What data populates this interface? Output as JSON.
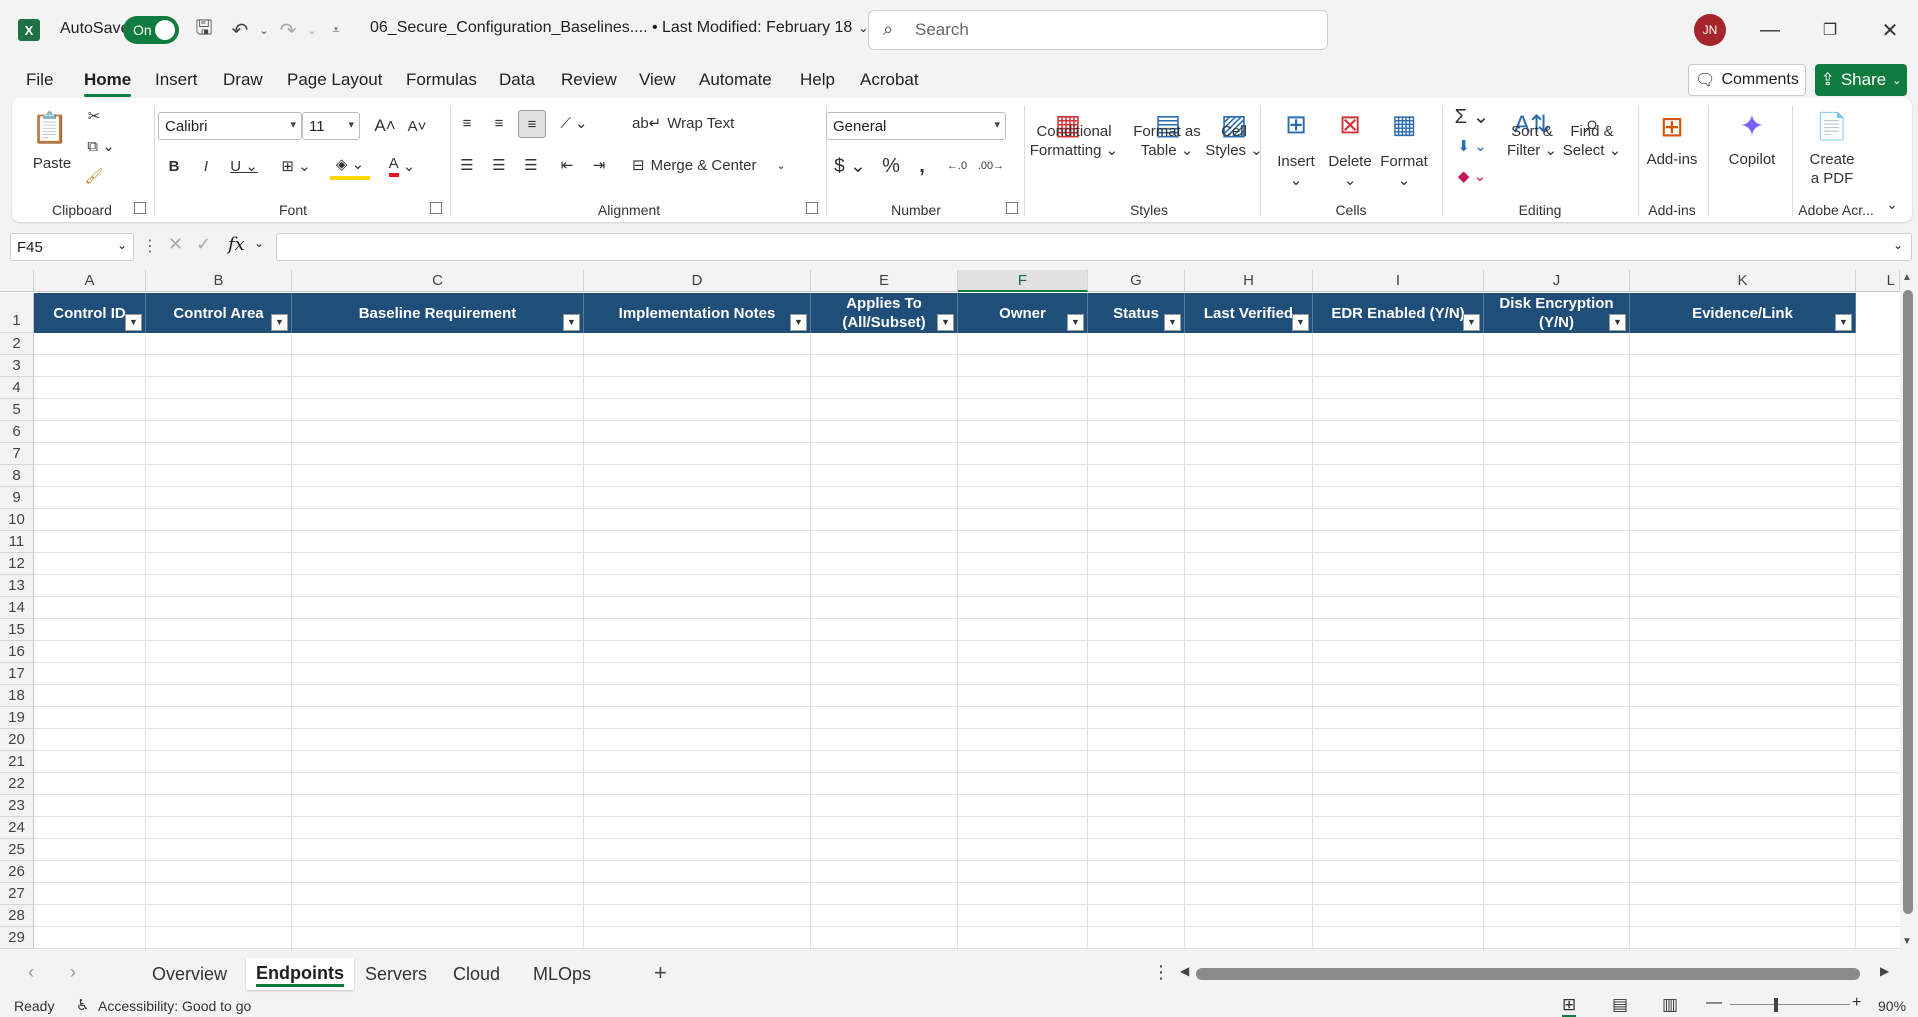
{
  "app": {
    "autosave_label": "AutoSave",
    "autosave_state": "On",
    "document_title": "06_Secure_Configuration_Baselines.... • Last Modified: February 18",
    "search_placeholder": "Search",
    "user_initials": "JN"
  },
  "menu": {
    "tabs": [
      "File",
      "Home",
      "Insert",
      "Draw",
      "Page Layout",
      "Formulas",
      "Data",
      "Review",
      "View",
      "Automate",
      "Help",
      "Acrobat"
    ],
    "active": "Home",
    "comments_label": "Comments",
    "share_label": "Share"
  },
  "ribbon": {
    "clipboard": {
      "paste": "Paste",
      "label": "Clipboard"
    },
    "font": {
      "name": "Calibri",
      "size": "11",
      "label": "Font"
    },
    "alignment": {
      "wrap": "Wrap Text",
      "merge": "Merge & Center",
      "label": "Alignment"
    },
    "number": {
      "format": "General",
      "label": "Number"
    },
    "styles": {
      "conditional_1": "Conditional",
      "conditional_2": "Formatting",
      "format_table_1": "Format as",
      "format_table_2": "Table",
      "cell_styles_1": "Cell",
      "cell_styles_2": "Styles",
      "label": "Styles"
    },
    "cells": {
      "insert": "Insert",
      "delete": "Delete",
      "format": "Format",
      "label": "Cells"
    },
    "editing": {
      "sort_1": "Sort &",
      "sort_2": "Filter",
      "find_1": "Find &",
      "find_2": "Select",
      "label": "Editing"
    },
    "addins": {
      "addins": "Add-ins",
      "label": "Add-ins"
    },
    "copilot": {
      "label": "Copilot"
    },
    "adobe": {
      "create_1": "Create",
      "create_2": "a PDF",
      "label": "Adobe Acr..."
    }
  },
  "formula_bar": {
    "name_box": "F45",
    "formula": ""
  },
  "sheet": {
    "columns": [
      "A",
      "B",
      "C",
      "D",
      "E",
      "F",
      "G",
      "H",
      "I",
      "J",
      "K",
      "L"
    ],
    "selected_column": "F",
    "header_row": {
      "A": "Control ID",
      "B": "Control Area",
      "C": "Baseline Requirement",
      "D": "Implementation Notes",
      "E1": "Applies To",
      "E2": "(All/Subset)",
      "F": "Owner",
      "G": "Status",
      "H": "Last Verified",
      "I": "EDR Enabled (Y/N)",
      "J1": "Disk Encryption",
      "J2": "(Y/N)",
      "K": "Evidence/Link"
    },
    "rows": [
      "1",
      "2",
      "3",
      "4",
      "5",
      "6",
      "7",
      "8",
      "9",
      "10",
      "11",
      "12",
      "13",
      "14",
      "15",
      "16",
      "17",
      "18",
      "19",
      "20",
      "21",
      "22",
      "23",
      "24",
      "25",
      "26",
      "27",
      "28",
      "29"
    ]
  },
  "sheet_tabs": {
    "tabs": [
      "Overview",
      "Endpoints",
      "Servers",
      "Cloud",
      "MLOps"
    ],
    "active": "Endpoints"
  },
  "status": {
    "ready": "Ready",
    "accessibility": "Accessibility: Good to go",
    "zoom": "90%"
  }
}
